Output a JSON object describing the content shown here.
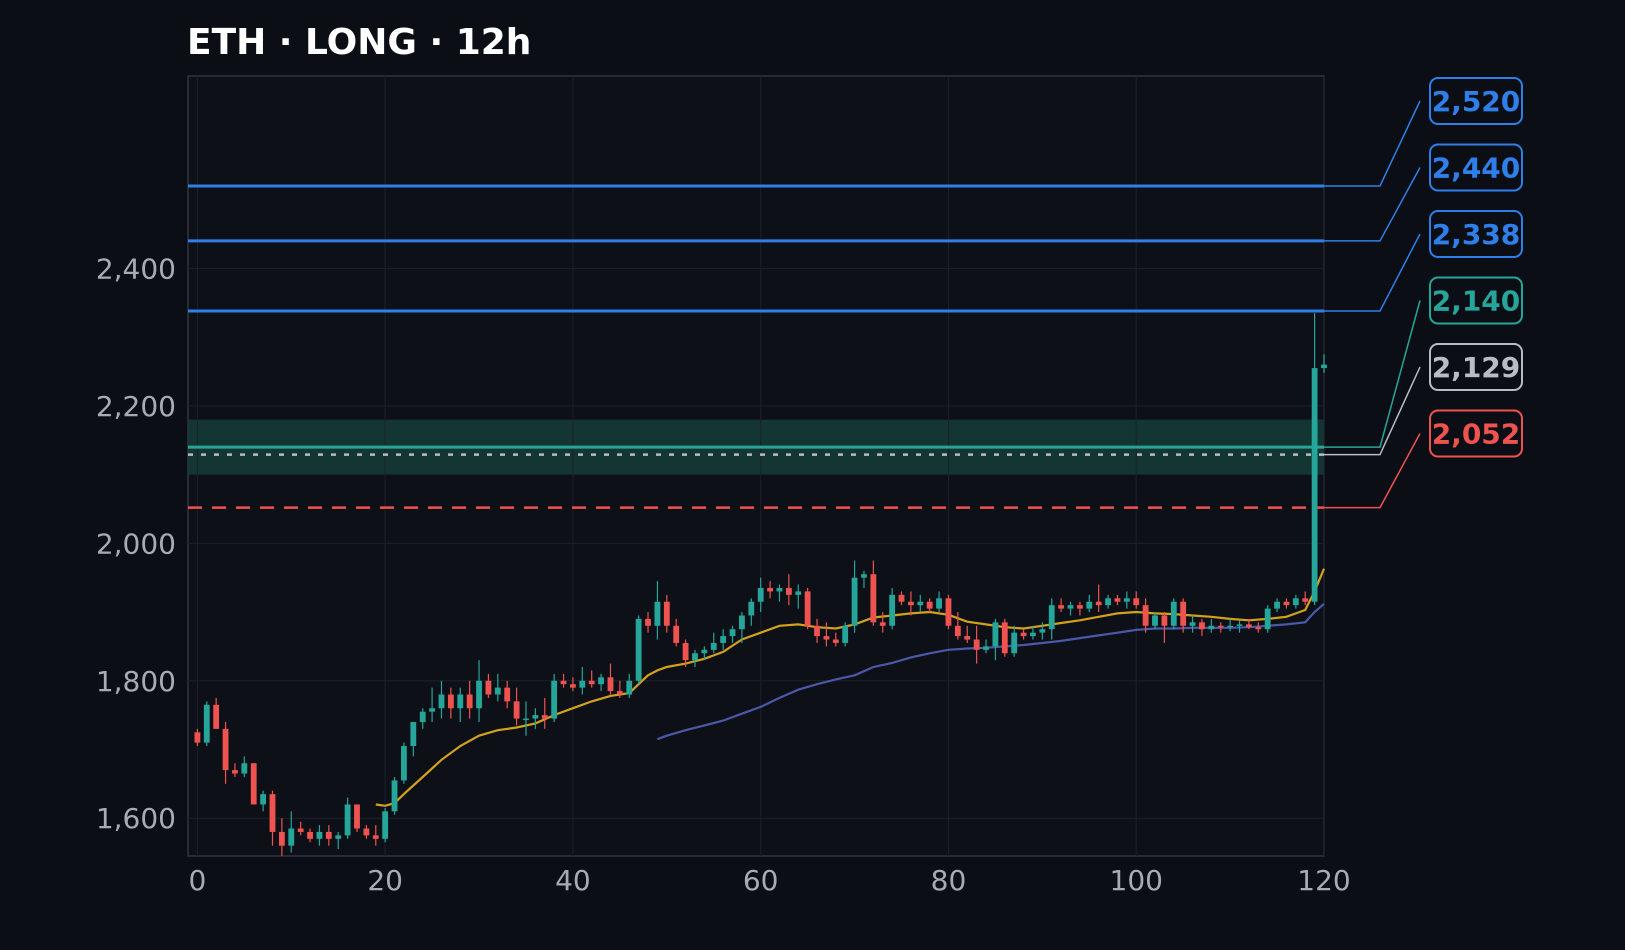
{
  "colors": {
    "background": "#0b0e15",
    "up": "#26a69a",
    "down": "#ef5350",
    "target": "#2f7fea",
    "entry": "#26a69a",
    "current": "#b8bcc4",
    "stop": "#ef5350",
    "ma_fast": "#d3a21c",
    "ma_slow": "#4a58a8",
    "grid": "#1c2029",
    "frame": "#30343e",
    "zone": "#163d38"
  },
  "chart_data": {
    "type": "candlestick",
    "title": "ETH · LONG · 12h",
    "xlim": [
      -1,
      120
    ],
    "ylim": [
      1545,
      2680
    ],
    "xticks": [
      0,
      20,
      40,
      60,
      80,
      100,
      120
    ],
    "yticks": [
      1600,
      1800,
      2000,
      2200,
      2400
    ],
    "ytick_labels": [
      "1,600",
      "1,800",
      "2,000",
      "2,200",
      "2,400"
    ],
    "grid": true,
    "entry_zone": [
      2100,
      2180
    ],
    "levels": [
      {
        "kind": "target",
        "value": 2520,
        "label": "2,520",
        "style": "solid"
      },
      {
        "kind": "target",
        "value": 2440,
        "label": "2,440",
        "style": "solid"
      },
      {
        "kind": "target",
        "value": 2338,
        "label": "2,338",
        "style": "solid"
      },
      {
        "kind": "entry",
        "value": 2140,
        "label": "2,140",
        "style": "solid"
      },
      {
        "kind": "current",
        "value": 2129,
        "label": "2,129",
        "style": "dotted"
      },
      {
        "kind": "stop",
        "value": 2052,
        "label": "2,052",
        "style": "dashed"
      }
    ],
    "candles": [
      [
        0,
        1725,
        1730,
        1705,
        1710
      ],
      [
        1,
        1710,
        1770,
        1705,
        1765
      ],
      [
        2,
        1765,
        1775,
        1730,
        1730
      ],
      [
        3,
        1730,
        1740,
        1650,
        1670
      ],
      [
        4,
        1670,
        1680,
        1660,
        1665
      ],
      [
        5,
        1665,
        1690,
        1660,
        1680
      ],
      [
        6,
        1680,
        1680,
        1620,
        1620
      ],
      [
        7,
        1620,
        1640,
        1610,
        1635
      ],
      [
        8,
        1635,
        1640,
        1560,
        1580
      ],
      [
        9,
        1580,
        1600,
        1545,
        1560
      ],
      [
        10,
        1560,
        1610,
        1550,
        1585
      ],
      [
        11,
        1585,
        1595,
        1575,
        1580
      ],
      [
        12,
        1580,
        1585,
        1565,
        1570
      ],
      [
        13,
        1570,
        1590,
        1560,
        1580
      ],
      [
        14,
        1580,
        1590,
        1560,
        1570
      ],
      [
        15,
        1570,
        1580,
        1555,
        1575
      ],
      [
        16,
        1575,
        1630,
        1570,
        1620
      ],
      [
        17,
        1620,
        1620,
        1580,
        1585
      ],
      [
        18,
        1585,
        1590,
        1570,
        1575
      ],
      [
        19,
        1575,
        1590,
        1560,
        1570
      ],
      [
        20,
        1570,
        1615,
        1565,
        1610
      ],
      [
        21,
        1610,
        1660,
        1605,
        1655
      ],
      [
        22,
        1655,
        1710,
        1650,
        1705
      ],
      [
        23,
        1705,
        1740,
        1690,
        1740
      ],
      [
        24,
        1740,
        1760,
        1730,
        1755
      ],
      [
        25,
        1755,
        1790,
        1740,
        1760
      ],
      [
        26,
        1760,
        1800,
        1745,
        1780
      ],
      [
        27,
        1780,
        1790,
        1745,
        1760
      ],
      [
        28,
        1760,
        1790,
        1740,
        1780
      ],
      [
        29,
        1780,
        1800,
        1745,
        1760
      ],
      [
        30,
        1760,
        1830,
        1740,
        1800
      ],
      [
        31,
        1800,
        1810,
        1775,
        1780
      ],
      [
        32,
        1780,
        1810,
        1770,
        1790
      ],
      [
        33,
        1790,
        1800,
        1760,
        1770
      ],
      [
        34,
        1770,
        1790,
        1735,
        1745
      ],
      [
        35,
        1745,
        1770,
        1720,
        1745
      ],
      [
        36,
        1745,
        1760,
        1730,
        1750
      ],
      [
        37,
        1750,
        1775,
        1730,
        1745
      ],
      [
        38,
        1745,
        1810,
        1740,
        1800
      ],
      [
        39,
        1800,
        1810,
        1790,
        1795
      ],
      [
        40,
        1795,
        1805,
        1785,
        1790
      ],
      [
        41,
        1790,
        1820,
        1780,
        1800
      ],
      [
        42,
        1800,
        1815,
        1790,
        1795
      ],
      [
        43,
        1795,
        1810,
        1785,
        1805
      ],
      [
        44,
        1805,
        1825,
        1780,
        1785
      ],
      [
        45,
        1785,
        1800,
        1775,
        1780
      ],
      [
        46,
        1780,
        1810,
        1775,
        1800
      ],
      [
        47,
        1800,
        1895,
        1795,
        1890
      ],
      [
        48,
        1890,
        1900,
        1870,
        1880
      ],
      [
        49,
        1880,
        1945,
        1860,
        1915
      ],
      [
        50,
        1915,
        1925,
        1870,
        1880
      ],
      [
        51,
        1880,
        1890,
        1850,
        1855
      ],
      [
        52,
        1855,
        1860,
        1820,
        1830
      ],
      [
        53,
        1830,
        1845,
        1820,
        1840
      ],
      [
        54,
        1840,
        1850,
        1830,
        1845
      ],
      [
        55,
        1845,
        1870,
        1840,
        1855
      ],
      [
        56,
        1855,
        1875,
        1845,
        1865
      ],
      [
        57,
        1865,
        1880,
        1855,
        1875
      ],
      [
        58,
        1875,
        1900,
        1855,
        1895
      ],
      [
        59,
        1895,
        1920,
        1880,
        1915
      ],
      [
        60,
        1915,
        1950,
        1900,
        1935
      ],
      [
        61,
        1935,
        1945,
        1920,
        1930
      ],
      [
        62,
        1930,
        1940,
        1915,
        1935
      ],
      [
        63,
        1935,
        1955,
        1910,
        1925
      ],
      [
        64,
        1925,
        1940,
        1905,
        1930
      ],
      [
        65,
        1930,
        1935,
        1875,
        1880
      ],
      [
        66,
        1880,
        1890,
        1855,
        1865
      ],
      [
        67,
        1865,
        1885,
        1850,
        1860
      ],
      [
        68,
        1860,
        1870,
        1850,
        1855
      ],
      [
        69,
        1855,
        1885,
        1850,
        1880
      ],
      [
        70,
        1880,
        1975,
        1870,
        1950
      ],
      [
        71,
        1950,
        1960,
        1935,
        1955
      ],
      [
        72,
        1955,
        1975,
        1880,
        1885
      ],
      [
        73,
        1885,
        1900,
        1870,
        1880
      ],
      [
        74,
        1880,
        1935,
        1875,
        1925
      ],
      [
        75,
        1925,
        1930,
        1910,
        1915
      ],
      [
        76,
        1915,
        1930,
        1895,
        1910
      ],
      [
        77,
        1910,
        1925,
        1900,
        1915
      ],
      [
        78,
        1915,
        1920,
        1900,
        1905
      ],
      [
        79,
        1905,
        1930,
        1900,
        1920
      ],
      [
        80,
        1920,
        1925,
        1875,
        1880
      ],
      [
        81,
        1880,
        1900,
        1860,
        1865
      ],
      [
        82,
        1865,
        1880,
        1855,
        1860
      ],
      [
        83,
        1860,
        1880,
        1825,
        1845
      ],
      [
        84,
        1845,
        1860,
        1840,
        1850
      ],
      [
        85,
        1850,
        1890,
        1830,
        1885
      ],
      [
        86,
        1885,
        1890,
        1835,
        1840
      ],
      [
        87,
        1840,
        1880,
        1835,
        1870
      ],
      [
        88,
        1870,
        1875,
        1860,
        1865
      ],
      [
        89,
        1865,
        1880,
        1860,
        1870
      ],
      [
        90,
        1870,
        1885,
        1860,
        1875
      ],
      [
        91,
        1875,
        1920,
        1860,
        1910
      ],
      [
        92,
        1910,
        1920,
        1900,
        1905
      ],
      [
        93,
        1905,
        1915,
        1895,
        1910
      ],
      [
        94,
        1910,
        1915,
        1895,
        1905
      ],
      [
        95,
        1905,
        1925,
        1900,
        1915
      ],
      [
        96,
        1915,
        1940,
        1900,
        1910
      ],
      [
        97,
        1910,
        1925,
        1905,
        1920
      ],
      [
        98,
        1920,
        1925,
        1910,
        1915
      ],
      [
        99,
        1915,
        1930,
        1905,
        1920
      ],
      [
        100,
        1920,
        1930,
        1905,
        1910
      ],
      [
        101,
        1910,
        1920,
        1870,
        1880
      ],
      [
        102,
        1880,
        1900,
        1875,
        1895
      ],
      [
        103,
        1895,
        1900,
        1855,
        1880
      ],
      [
        104,
        1880,
        1920,
        1875,
        1915
      ],
      [
        105,
        1915,
        1920,
        1870,
        1880
      ],
      [
        106,
        1880,
        1895,
        1870,
        1885
      ],
      [
        107,
        1885,
        1890,
        1865,
        1875
      ],
      [
        108,
        1875,
        1890,
        1870,
        1880
      ],
      [
        109,
        1880,
        1885,
        1870,
        1878
      ],
      [
        110,
        1878,
        1890,
        1872,
        1880
      ],
      [
        111,
        1880,
        1888,
        1870,
        1882
      ],
      [
        112,
        1882,
        1890,
        1875,
        1878
      ],
      [
        113,
        1878,
        1885,
        1870,
        1875
      ],
      [
        114,
        1875,
        1910,
        1870,
        1905
      ],
      [
        115,
        1905,
        1920,
        1900,
        1915
      ],
      [
        116,
        1915,
        1920,
        1905,
        1910
      ],
      [
        117,
        1910,
        1925,
        1905,
        1920
      ],
      [
        118,
        1920,
        1930,
        1910,
        1915
      ],
      [
        119,
        1915,
        2335,
        1910,
        2255
      ],
      [
        120,
        2255,
        2275,
        2248,
        2260
      ]
    ],
    "ma_fast": {
      "x": [
        19,
        20,
        21,
        22,
        24,
        26,
        28,
        30,
        32,
        34,
        36,
        38,
        40,
        42,
        44,
        46,
        47,
        48,
        49,
        50,
        52,
        54,
        56,
        58,
        60,
        62,
        64,
        66,
        68,
        70,
        72,
        74,
        76,
        78,
        80,
        82,
        84,
        86,
        88,
        90,
        92,
        94,
        96,
        98,
        100,
        102,
        104,
        106,
        108,
        110,
        112,
        114,
        116,
        117,
        118,
        119,
        120
      ],
      "y": [
        1620,
        1618,
        1622,
        1635,
        1660,
        1685,
        1705,
        1720,
        1728,
        1732,
        1738,
        1750,
        1760,
        1770,
        1778,
        1782,
        1795,
        1808,
        1815,
        1820,
        1825,
        1832,
        1842,
        1860,
        1870,
        1880,
        1882,
        1878,
        1876,
        1882,
        1892,
        1895,
        1898,
        1900,
        1896,
        1886,
        1882,
        1878,
        1876,
        1880,
        1884,
        1888,
        1893,
        1898,
        1900,
        1898,
        1897,
        1895,
        1893,
        1890,
        1888,
        1890,
        1893,
        1898,
        1903,
        1930,
        1963
      ]
    },
    "ma_slow": {
      "x": [
        49,
        50,
        52,
        54,
        56,
        58,
        60,
        62,
        64,
        66,
        68,
        70,
        72,
        74,
        76,
        78,
        80,
        82,
        84,
        86,
        88,
        90,
        92,
        94,
        96,
        98,
        100,
        102,
        104,
        106,
        108,
        110,
        112,
        114,
        116,
        118,
        119,
        120
      ],
      "y": [
        1715,
        1720,
        1728,
        1735,
        1742,
        1752,
        1762,
        1775,
        1787,
        1795,
        1802,
        1808,
        1820,
        1826,
        1834,
        1840,
        1845,
        1847,
        1848,
        1850,
        1852,
        1855,
        1858,
        1862,
        1866,
        1870,
        1874,
        1876,
        1876,
        1877,
        1877,
        1877,
        1878,
        1880,
        1882,
        1885,
        1900,
        1912
      ]
    }
  }
}
